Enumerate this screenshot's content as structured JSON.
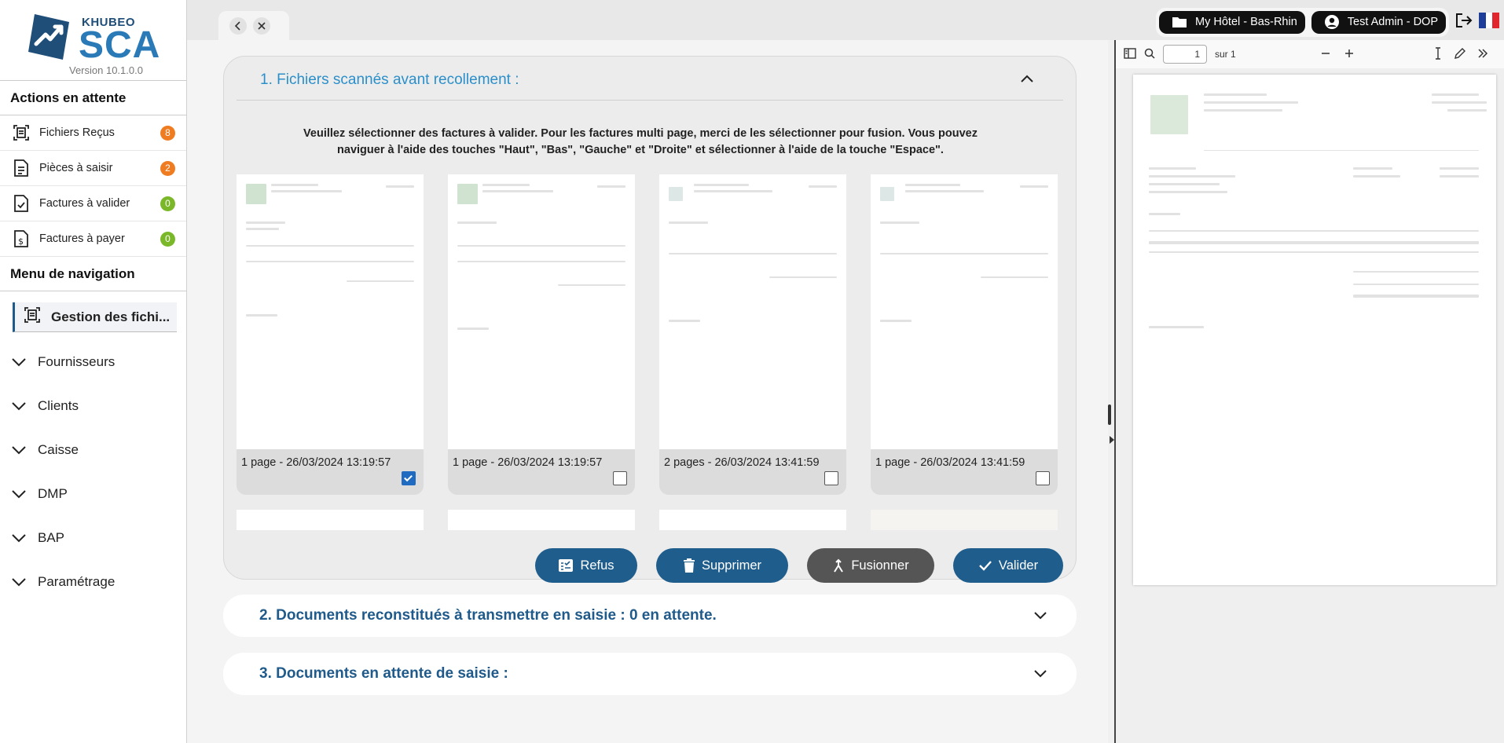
{
  "logo": {
    "top": "KHUBEO",
    "main": "SCA",
    "version": "Version 10.1.0.0"
  },
  "sidebar": {
    "actions_title": "Actions en attente",
    "actions": [
      {
        "label": "Fichiers Reçus",
        "count": "8",
        "badge_color": "#f07c22",
        "icon": "scan-document-icon"
      },
      {
        "label": "Pièces à saisir",
        "count": "2",
        "badge_color": "#f07c22",
        "icon": "document-icon"
      },
      {
        "label": "Factures à valider",
        "count": "0",
        "badge_color": "#7ab829",
        "icon": "document-check-icon"
      },
      {
        "label": "Factures à payer",
        "count": "0",
        "badge_color": "#7ab829",
        "icon": "document-dollar-icon"
      }
    ],
    "nav_title": "Menu de navigation",
    "nav_active": "Gestion des fichi...",
    "nav_items": [
      "Fournisseurs",
      "Clients",
      "Caisse",
      "DMP",
      "BAP",
      "Paramétrage"
    ]
  },
  "topbar": {
    "hotel": "My Hôtel - Bas-Rhin",
    "user": "Test Admin - DOP"
  },
  "panel1": {
    "title": "1. Fichiers scannés avant recollement :",
    "instructions": "Veuillez sélectionner des factures à valider. Pour les factures multi page, merci de les sélectionner pour fusion. Vous pouvez naviguer à l'aide des touches \"Haut\", \"Bas\", \"Gauche\" et \"Droite\" et sélectionner à l'aide de la touche \"Espace\".",
    "cards": [
      {
        "caption": "1 page - 26/03/2024 13:19:57",
        "checked": true
      },
      {
        "caption": "1 page - 26/03/2024 13:19:57",
        "checked": false
      },
      {
        "caption": "2 pages - 26/03/2024 13:41:59",
        "checked": false
      },
      {
        "caption": "1 page - 26/03/2024 13:41:59",
        "checked": false
      }
    ],
    "buttons": {
      "refus": "Refus",
      "supprimer": "Supprimer",
      "fusionner": "Fusionner",
      "valider": "Valider"
    }
  },
  "panel2": {
    "title": "2. Documents reconstitués à transmettre en saisie : 0 en attente."
  },
  "panel3": {
    "title": "3. Documents en attente de saisie :"
  },
  "viewer": {
    "page_number": "1",
    "page_total": "sur 1"
  },
  "colors": {
    "brand_blue": "#1e5d8c",
    "title_blue": "#2b8fc9",
    "badge_orange": "#f07c22",
    "badge_green": "#7ab829"
  }
}
